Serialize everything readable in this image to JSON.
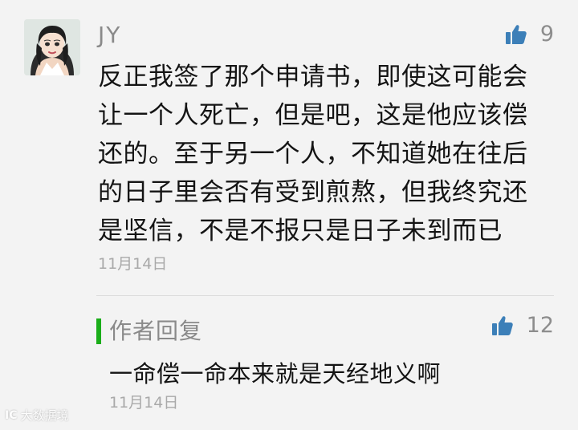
{
  "comment": {
    "username": "JY",
    "avatar_icon": "avatar-girl-illustration",
    "like_count": "9",
    "text": "反正我签了那个申请书，即使这可能会让一个人死亡，但是吧，这是他应该偿还的。至于另一个人，不知道她在往后的日子里会否有受到煎熬，但我终究还是坚信，不是不报只是日子未到而已",
    "date": "11月14日"
  },
  "reply": {
    "label": "作者回复",
    "like_count": "12",
    "text": "一命偿一命本来就是天经地义啊",
    "date": "11月14日"
  },
  "watermark": {
    "mark": "IC",
    "text": "大数据境"
  },
  "colors": {
    "accent_green": "#1aad19",
    "like_blue": "#3c7fb8",
    "background": "#f3f3f3"
  }
}
